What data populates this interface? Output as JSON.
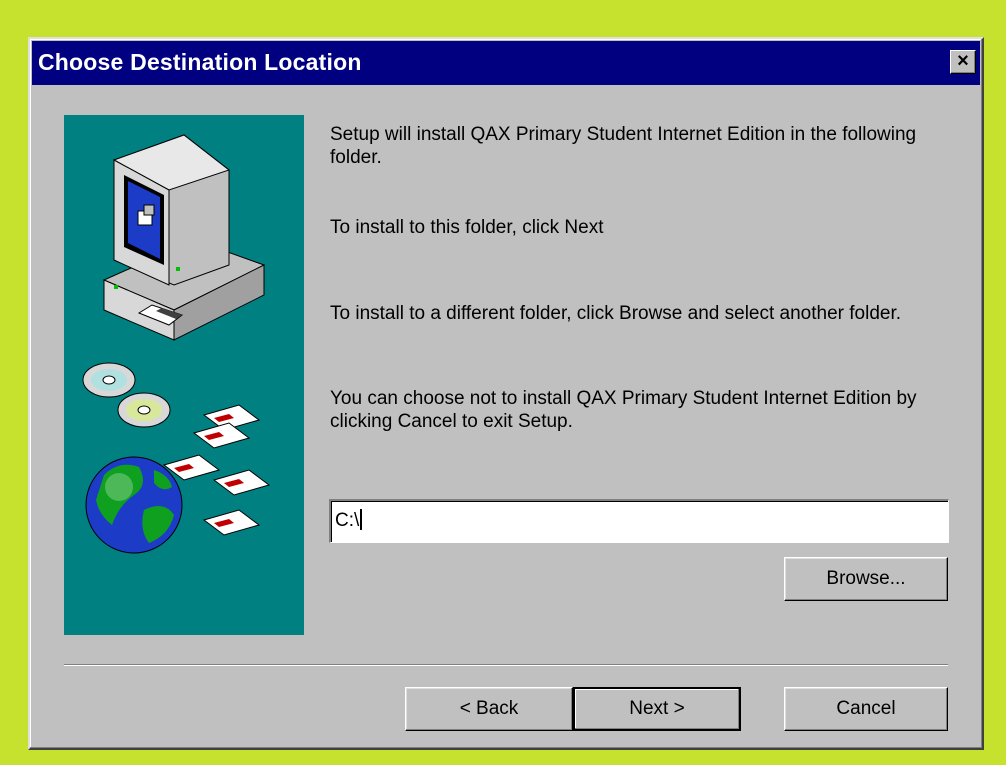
{
  "window": {
    "title": "Choose Destination Location",
    "close_label": "×"
  },
  "content": {
    "paragraph1": "Setup will install QAX Primary Student Internet Edition in the following folder.",
    "paragraph2": "To install to this folder, click Next",
    "paragraph3": "To install to a different folder, click Browse and select another folder.",
    "paragraph4": "You can choose not to install QAX Primary Student Internet Edition by clicking Cancel to exit Setup."
  },
  "destination": {
    "path_value": "C:\\"
  },
  "buttons": {
    "browse": "Browse...",
    "back": "< Back",
    "next": "Next >",
    "cancel": "Cancel"
  },
  "colors": {
    "background": "#c7e12f",
    "titlebar": "#000080",
    "art_panel": "#008080",
    "face": "#c0c0c0"
  },
  "icons": [
    "computer-icon",
    "cd-icon",
    "globe-icon",
    "floppy-disk-icon"
  ]
}
